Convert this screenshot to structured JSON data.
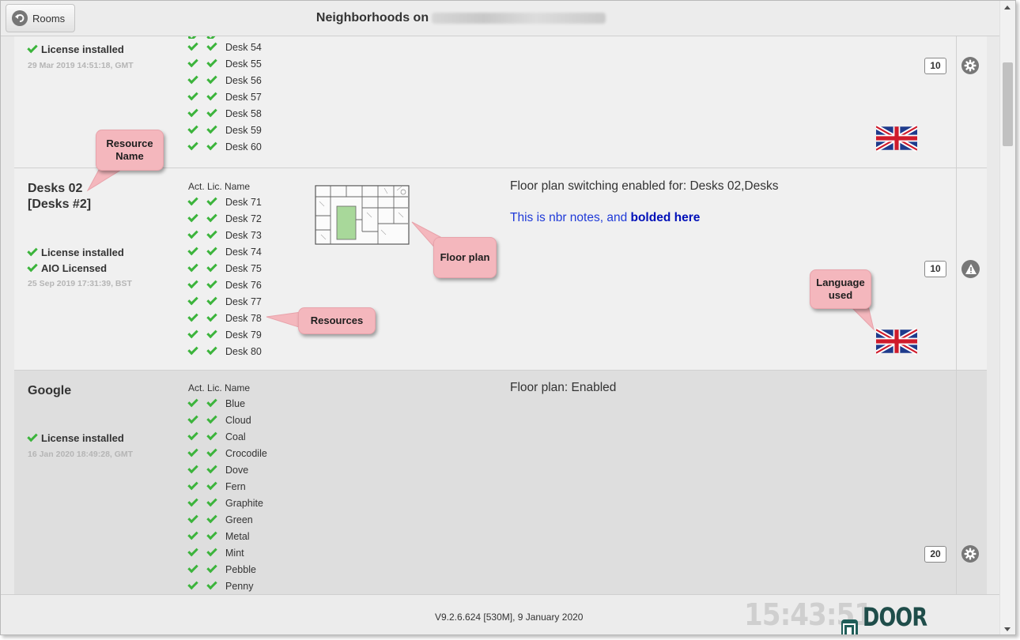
{
  "header": {
    "rooms_label": "Rooms",
    "title": "Neighborhoods on"
  },
  "rows": [
    {
      "license_installed": "License installed",
      "date": "29 Mar 2019 14:51:18, GMT",
      "resources": [
        "Desk 54",
        "Desk 55",
        "Desk 56",
        "Desk 57",
        "Desk 58",
        "Desk 59",
        "Desk 60"
      ],
      "count": "10"
    },
    {
      "name_line1": "Desks 02",
      "name_line2": "[Desks #2]",
      "license_installed": "License installed",
      "aio_licensed": "AIO Licensed",
      "date": "25 Sep 2019 17:31:39, BST",
      "col_act": "Act.",
      "col_lic": "Lic.",
      "col_name": "Name",
      "resources": [
        "Desk 71",
        "Desk 72",
        "Desk 73",
        "Desk 74",
        "Desk 75",
        "Desk 76",
        "Desk 77",
        "Desk 78",
        "Desk 79",
        "Desk 80"
      ],
      "notes": "Floor plan switching enabled for: Desks 02,Desks",
      "notes_blue": "This is nbr notes, and ",
      "notes_bold": "bolded here",
      "count": "10"
    },
    {
      "name_line1": "Google",
      "license_installed": "License installed",
      "date": "16 Jan 2020 18:49:28, GMT",
      "col_act": "Act.",
      "col_lic": "Lic.",
      "col_name": "Name",
      "resources": [
        "Blue",
        "Cloud",
        "Coal",
        "Crocodile",
        "Dove",
        "Fern",
        "Graphite",
        "Green",
        "Metal",
        "Mint",
        "Pebble",
        "Penny"
      ],
      "notes": "Floor plan: Enabled",
      "count": "20"
    }
  ],
  "callouts": {
    "resource_name": "Resource Name",
    "floor_plan": "Floor plan",
    "resources": "Resources",
    "language_used": "Language used"
  },
  "footer": {
    "version": "V9.2.6.624 [530M], 9 January 2020",
    "clock": "15:43:51",
    "brand": "DOOR TABLET"
  },
  "icons": {
    "back": "back-arrow-icon",
    "settings": "gear-icon",
    "warning": "warning-icon",
    "flag": "uk-flag-icon",
    "check": "checkmark-icon"
  },
  "colors": {
    "check": "#3cb43c",
    "callout": "#f4b7bd",
    "notes_blue": "#1f3ad8"
  }
}
